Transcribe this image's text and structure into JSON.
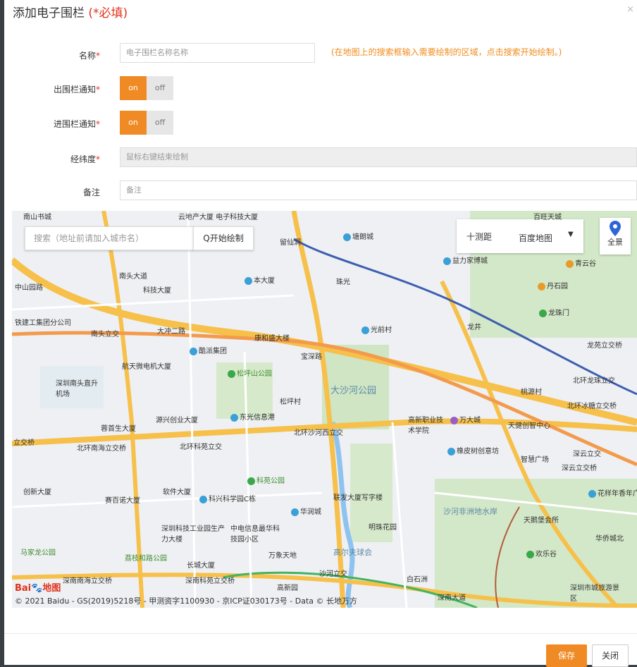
{
  "dialog": {
    "title": "添加电子围栏",
    "required_note": "(*必填)",
    "close": "×"
  },
  "form": {
    "name_label": "名称",
    "name_placeholder": "电子围栏名称名称",
    "hint": "(在地图上的搜索框输入需要绘制的区域，点击搜索开始绘制。)",
    "exit_label": "出围栏通知",
    "enter_label": "进围栏通知",
    "toggle_on": "on",
    "toggle_off": "off",
    "coords_label": "经纬度",
    "coords_placeholder": "鼠标右键结束绘制",
    "remark_label": "备注",
    "remark_placeholder": "备注",
    "required_star": "*"
  },
  "map": {
    "search_placeholder": "搜索（地址前请加入城市名）",
    "search_button": "Q开始绘制",
    "measure": "十测距",
    "layer": "百度地图",
    "layer_arrow": "▼",
    "panorama": "全景",
    "logo": "Bai",
    "logo_suffix": "地图",
    "copyright": "© 2021 Baidu - GS(2019)5218号 - 甲测资字1100930 - 京ICP证030173号 - Data © 长地万方",
    "places": [
      {
        "id": "p1",
        "text": "南山书城"
      },
      {
        "id": "p2",
        "text": "云地产大厦 电子科技大厦"
      },
      {
        "id": "p3",
        "text": "塘朗城"
      },
      {
        "id": "p4",
        "text": "百旺天城"
      },
      {
        "id": "p5",
        "text": "留仙洞"
      },
      {
        "id": "p6",
        "text": "益力家博城"
      },
      {
        "id": "p7",
        "text": "青云谷"
      },
      {
        "id": "p8",
        "text": "中山园路"
      },
      {
        "id": "p9",
        "text": "科技大厦"
      },
      {
        "id": "p10",
        "text": "本大厦"
      },
      {
        "id": "p11",
        "text": "珠光"
      },
      {
        "id": "p12",
        "text": "丹石园"
      },
      {
        "id": "p13",
        "text": "铁建工集团分公司"
      },
      {
        "id": "p14",
        "text": "南头立交"
      },
      {
        "id": "p15",
        "text": "大冲二路"
      },
      {
        "id": "p16",
        "text": "光前村"
      },
      {
        "id": "p17",
        "text": "龙井"
      },
      {
        "id": "p18",
        "text": "龙珠门"
      },
      {
        "id": "p19",
        "text": "龙苑立交桥"
      },
      {
        "id": "p20",
        "text": "康和盛大楼"
      },
      {
        "id": "p21",
        "text": "酷派集团"
      },
      {
        "id": "p22",
        "text": "宝深路"
      },
      {
        "id": "p23",
        "text": "航天微电机大厦"
      },
      {
        "id": "p24",
        "text": "深圳南头直升机场"
      },
      {
        "id": "p25",
        "text": "松坪山公园"
      },
      {
        "id": "p26",
        "text": "大沙河公园"
      },
      {
        "id": "p27",
        "text": "桃源村"
      },
      {
        "id": "p28",
        "text": "北环龙珠立交"
      },
      {
        "id": "p29",
        "text": "松坪村"
      },
      {
        "id": "p30",
        "text": "源兴创业大厦"
      },
      {
        "id": "p31",
        "text": "东光信息港"
      },
      {
        "id": "p32",
        "text": "高新职业技术学院"
      },
      {
        "id": "p33",
        "text": "万大城"
      },
      {
        "id": "p34",
        "text": "天健创智中心"
      },
      {
        "id": "p35",
        "text": "北环冰糖立交桥"
      },
      {
        "id": "p36",
        "text": "蓉首生大厦"
      },
      {
        "id": "p37",
        "text": "北环沙河西立交"
      },
      {
        "id": "p38",
        "text": "立交桥"
      },
      {
        "id": "p39",
        "text": "北环南海立交桥"
      },
      {
        "id": "p40",
        "text": "北环科苑立交"
      },
      {
        "id": "p41",
        "text": "橡皮树创意坊"
      },
      {
        "id": "p42",
        "text": "深云立交"
      },
      {
        "id": "p43",
        "text": "智慧广场"
      },
      {
        "id": "p44",
        "text": "深云立交桥"
      },
      {
        "id": "p45",
        "text": "创新大厦"
      },
      {
        "id": "p46",
        "text": "软件大厦"
      },
      {
        "id": "p47",
        "text": "科苑公园"
      },
      {
        "id": "p48",
        "text": "花样年香年广"
      },
      {
        "id": "p49",
        "text": "赛百诺大厦"
      },
      {
        "id": "p50",
        "text": "科兴科学园C栋"
      },
      {
        "id": "p51",
        "text": "联发大厦写字楼"
      },
      {
        "id": "p52",
        "text": "华润城"
      },
      {
        "id": "p53",
        "text": "深圳科技工业园生产力大楼"
      },
      {
        "id": "p54",
        "text": "中电信息最华科技园小区"
      },
      {
        "id": "p55",
        "text": "沙河非洲地水岸"
      },
      {
        "id": "p56",
        "text": "天鹅堡会所"
      },
      {
        "id": "p57",
        "text": "明珠花园"
      },
      {
        "id": "p58",
        "text": "华侨城北"
      },
      {
        "id": "p59",
        "text": "万象天地"
      },
      {
        "id": "p60",
        "text": "高尔夫球会"
      },
      {
        "id": "p61",
        "text": "欢乐谷"
      },
      {
        "id": "p62",
        "text": "马家龙公园"
      },
      {
        "id": "p63",
        "text": "荔枝和路公园"
      },
      {
        "id": "p64",
        "text": "长城大厦"
      },
      {
        "id": "p65",
        "text": "深南科苑立交桥"
      },
      {
        "id": "p66",
        "text": "高新园"
      },
      {
        "id": "p67",
        "text": "沙河立交"
      },
      {
        "id": "p68",
        "text": "白石洲"
      },
      {
        "id": "p69",
        "text": "深南大道"
      },
      {
        "id": "p70",
        "text": "深圳市城旅游景区"
      },
      {
        "id": "p71",
        "text": "深南南海立交桥"
      },
      {
        "id": "p72",
        "text": "南头大道"
      }
    ]
  },
  "buttons": {
    "save": "保存",
    "close": "关闭"
  },
  "colors": {
    "accent": "#f08a24",
    "required": "#e0331c",
    "hint": "#f08d1e"
  }
}
